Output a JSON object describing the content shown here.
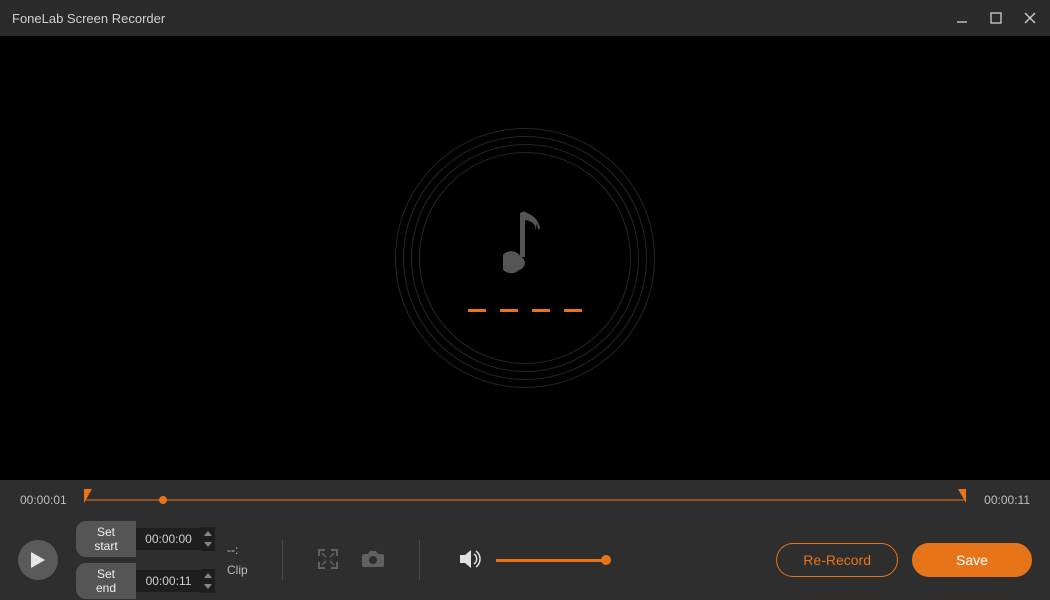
{
  "title": "FoneLab Screen Recorder",
  "timeline": {
    "current": "00:00:01",
    "total": "00:00:11"
  },
  "clip": {
    "start_label": "Set start",
    "start_time": "00:00:00",
    "end_label": "Set end",
    "end_time": "00:00:11",
    "dashes": "--:",
    "label": "Clip",
    "dashes2": "--:"
  },
  "buttons": {
    "rerecord": "Re-Record",
    "save": "Save"
  },
  "colors": {
    "accent": "#e8741a"
  }
}
